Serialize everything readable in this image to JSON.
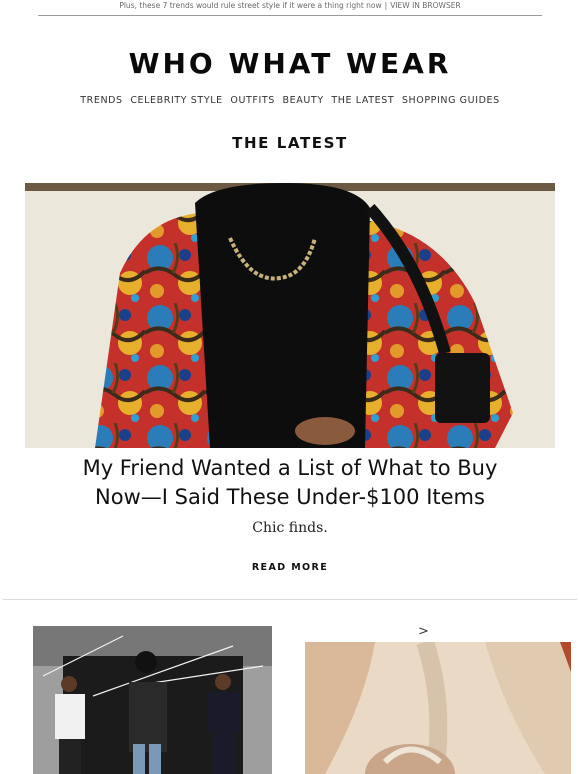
{
  "preheader": {
    "text": "Plus, these 7 trends would rule street style if it were a thing right now",
    "separator": "|",
    "link": "VIEW IN BROWSER"
  },
  "brand": {
    "logo": "WHO WHAT WEAR"
  },
  "nav": {
    "items": [
      "TRENDS",
      "CELEBRITY STYLE",
      "OUTFITS",
      "BEAUTY",
      "THE LATEST",
      "SHOPPING GUIDES"
    ]
  },
  "section": {
    "title": "THE LATEST"
  },
  "feature": {
    "headline_line1": "My Friend Wanted a List of What to Buy",
    "headline_line2": "Now—I Said These Under-$100 Items",
    "dek": "Chic finds.",
    "cta": "READ MORE"
  },
  "secondary": {
    "arrow": ">"
  },
  "colors": {
    "text": "#111111",
    "muted": "#6a6a6a",
    "rule": "#dcdcdc"
  }
}
